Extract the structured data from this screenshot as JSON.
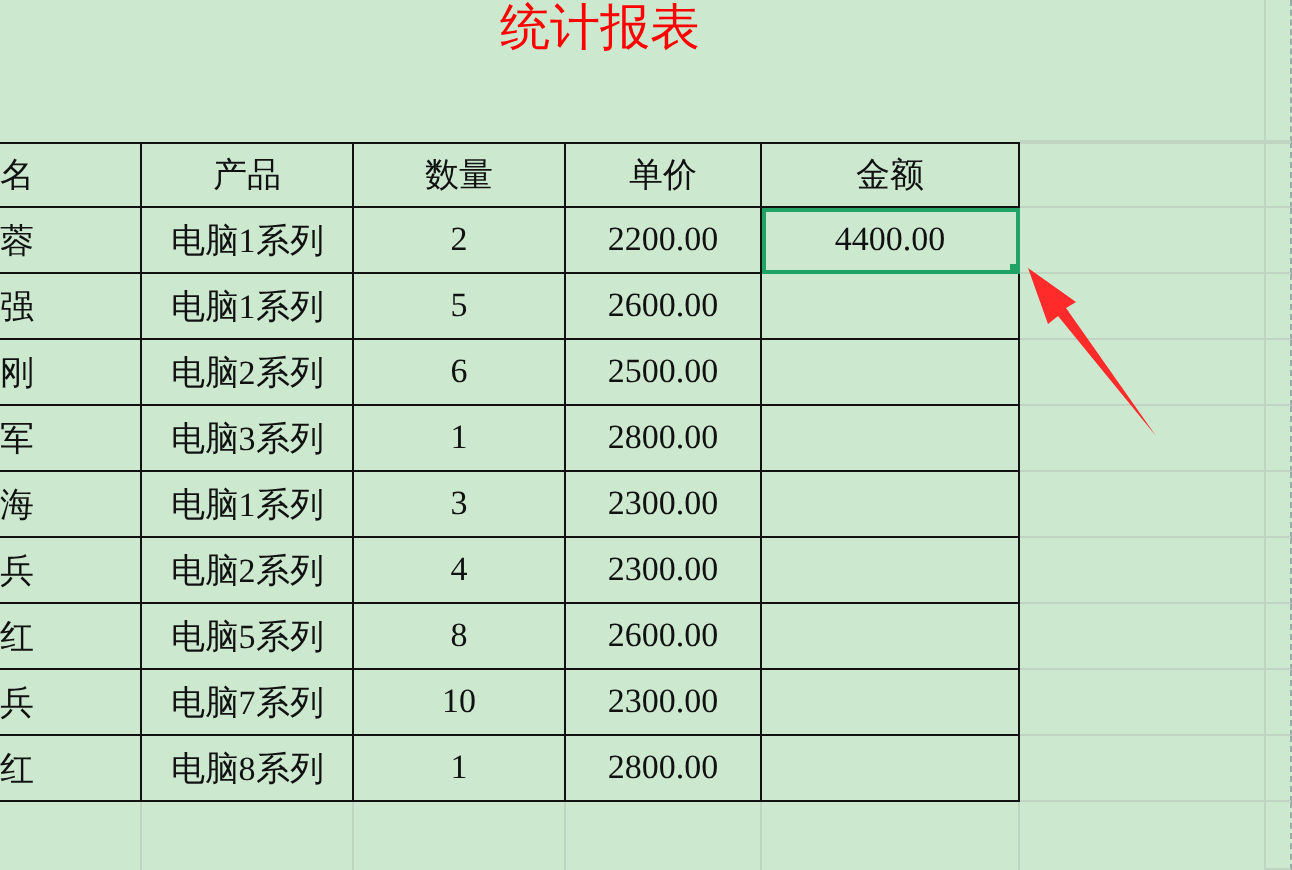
{
  "title": "统计报表",
  "columns": [
    "名",
    "产品",
    "数量",
    "单价",
    "金额"
  ],
  "rows": [
    {
      "name": "蓉",
      "product": "电脑1系列",
      "qty": "2",
      "price": "2200.00",
      "amount": "4400.00",
      "selected": true
    },
    {
      "name": "强",
      "product": "电脑1系列",
      "qty": "5",
      "price": "2600.00",
      "amount": "",
      "selected": false
    },
    {
      "name": "刚",
      "product": "电脑2系列",
      "qty": "6",
      "price": "2500.00",
      "amount": "",
      "selected": false
    },
    {
      "name": "军",
      "product": "电脑3系列",
      "qty": "1",
      "price": "2800.00",
      "amount": "",
      "selected": false
    },
    {
      "name": "海",
      "product": "电脑1系列",
      "qty": "3",
      "price": "2300.00",
      "amount": "",
      "selected": false
    },
    {
      "name": "兵",
      "product": "电脑2系列",
      "qty": "4",
      "price": "2300.00",
      "amount": "",
      "selected": false
    },
    {
      "name": "红",
      "product": "电脑5系列",
      "qty": "8",
      "price": "2600.00",
      "amount": "",
      "selected": false
    },
    {
      "name": "兵",
      "product": "电脑7系列",
      "qty": "10",
      "price": "2300.00",
      "amount": "",
      "selected": false
    },
    {
      "name": "红",
      "product": "电脑8系列",
      "qty": "1",
      "price": "2800.00",
      "amount": "",
      "selected": false
    }
  ]
}
